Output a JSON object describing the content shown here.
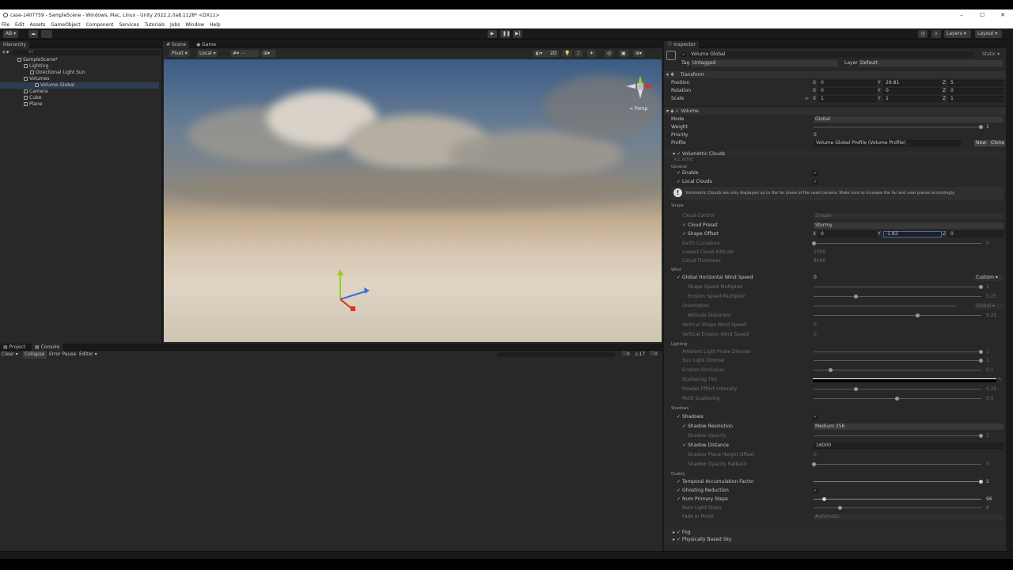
{
  "window": {
    "title": "case-1407759 - SampleScene - Windows, Mac, Linux - Unity 2022.2.0a8.1128* <DX11>"
  },
  "menu": [
    "File",
    "Edit",
    "Assets",
    "GameObject",
    "Component",
    "Services",
    "Tutorials",
    "Jobs",
    "Window",
    "Help"
  ],
  "toolbar": {
    "account": "AB",
    "layers": "Layers",
    "layout": "Layout"
  },
  "hierarchy": {
    "tab": "Hierarchy",
    "search_placeholder": "All",
    "items": [
      {
        "label": "SampleScene*",
        "depth": 0
      },
      {
        "label": "Lighting",
        "depth": 1
      },
      {
        "label": "Directional Light Sun",
        "depth": 2
      },
      {
        "label": "Volumes",
        "depth": 1
      },
      {
        "label": "Volume Global",
        "depth": 2,
        "selected": true
      },
      {
        "label": "Camera",
        "depth": 1
      },
      {
        "label": "Cube",
        "depth": 1
      },
      {
        "label": "Plane",
        "depth": 1
      }
    ]
  },
  "scene": {
    "tabs": [
      "Scene",
      "Game"
    ],
    "pivot": "Pivot",
    "local": "Local",
    "mode": "2D",
    "persp": "< Persp"
  },
  "console": {
    "tabs": [
      "Project",
      "Console"
    ],
    "buttons": [
      "Clear",
      "Collapse",
      "Error Pause",
      "Editor"
    ],
    "counts": [
      "0",
      "17",
      "0"
    ]
  },
  "inspector": {
    "tab": "Inspector",
    "object_name": "Volume Global",
    "static": "Static",
    "tag_label": "Tag",
    "tag_value": "Untagged",
    "layer_label": "Layer",
    "layer_value": "Default",
    "transform": {
      "title": "Transform",
      "position": {
        "label": "Position",
        "x": "0",
        "y": "29.81",
        "z": "5"
      },
      "rotation": {
        "label": "Rotation",
        "x": "0",
        "y": "0",
        "z": "0"
      },
      "scale": {
        "label": "Scale",
        "x": "1",
        "y": "1",
        "z": "1"
      }
    },
    "volume": {
      "title": "Volume",
      "mode_label": "Mode",
      "mode": "Global",
      "weight_label": "Weight",
      "weight": "1",
      "priority_label": "Priority",
      "priority": "0",
      "profile_label": "Profile",
      "profile": "Volume Global Profile (Volume Profile)",
      "new": "New",
      "clone": "Clone"
    },
    "clouds": {
      "title": "Volumetric Clouds",
      "all_none": "ALL NONE",
      "general": "General",
      "enable": "Enable",
      "local_clouds": "Local Clouds",
      "info": "Volumetric Clouds are only displayed up to the far plane of the used camera. Make sure to increase the far and near planes accordingly.",
      "shape": "Shape",
      "cloud_control": "Cloud Control",
      "cloud_control_val": "Simple",
      "cloud_preset": "Cloud Preset",
      "cloud_preset_val": "Stormy",
      "shape_offset": "Shape Offset",
      "so_x": "0",
      "so_y": "-1.83",
      "so_z": "0",
      "earth_curv": "Earth Curvature",
      "earth_curv_val": "0",
      "lowest_alt": "Lowest Cloud Altitude",
      "lowest_alt_val": "1000",
      "thickness": "Cloud Thickness",
      "thickness_val": "8000",
      "wind": "Wind",
      "ghws": "Global Horizontal Wind Speed",
      "ghws_val": "0",
      "ghws_mode": "Custom",
      "ssm": "Shape Speed Multiplier",
      "ssm_val": "1",
      "esm": "Erosion Speed Multiplier",
      "esm_val": "0.25",
      "orient": "Orientation",
      "orient_val": "Global",
      "alt_dist": "Altitude Distortion",
      "alt_dist_val": "0.25",
      "vsws": "Vertical Shape Wind Speed",
      "vsws_val": "0",
      "vews": "Vertical Erosion Wind Speed",
      "vews_val": "0",
      "lighting": "Lighting",
      "alpd": "Ambient Light Probe Dimmer",
      "alpd_val": "1",
      "sld": "Sun Light Dimmer",
      "sld_val": "1",
      "eo": "Erosion Occlusion",
      "eo_val": "0.1",
      "st": "Scattering Tint",
      "pei": "Powder Effect Intensity",
      "pei_val": "0.25",
      "ms": "Multi Scattering",
      "ms_val": "0.5",
      "shadows_sect": "Shadows",
      "shadows": "Shadows",
      "shad_res": "Shadow Resolution",
      "shad_res_val": "Medium 256",
      "shad_op": "Shadow Opacity",
      "shad_op_val": "1",
      "shad_dist": "Shadow Distance",
      "shad_dist_val": "16000",
      "spho": "Shadow Plane Height Offset",
      "spho_val": "0",
      "sof": "Shadow Opacity Fallback",
      "sof_val": "0",
      "quality": "Quality",
      "taf": "Temporal Accumulation Factor",
      "taf_val": "1",
      "gr": "Ghosting Reduction",
      "nps": "Num Primary Steps",
      "nps_val": "96",
      "nls": "Num Light Steps",
      "nls_val": "6",
      "fim": "Fade In Mode",
      "fim_val": "Automatic"
    },
    "fog": "Fog",
    "pbs": "Physically Based Sky"
  }
}
